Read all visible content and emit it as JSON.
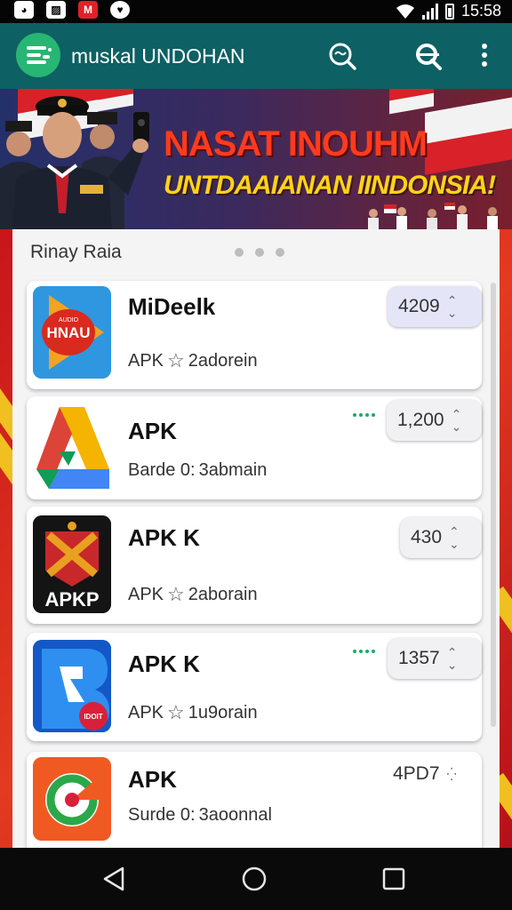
{
  "status_bar": {
    "time": "15:58",
    "icons": [
      "cat-icon",
      "image-icon",
      "gmail-icon",
      "heart-icon"
    ],
    "wifi_icon": "wifi-icon",
    "signal_icon": "signal-icon",
    "battery_icon": "battery-icon"
  },
  "app_bar": {
    "title": "muskal UNDOHAN",
    "logo_icon": "menu-logo-icon",
    "action_icons": [
      "search-icon",
      "search-alt-icon",
      "more-vert-icon"
    ],
    "color": "#0d6063",
    "logo_color": "#27b673"
  },
  "banner": {
    "title_line1": "NASAT INOUHM",
    "title_line2": "UNTDAAIANAN IINDONSIA!",
    "title1_color": "#ff3b1d",
    "title2_color": "#ffd21a"
  },
  "list": {
    "header": "Rinay Raia",
    "items": [
      {
        "name": "MiDeelk",
        "sub_prefix": "APK",
        "sub_icon": "star-icon",
        "sub_text": "2adorein",
        "count": "4209",
        "icon_label": "HNAU",
        "icon_brand": "AUDIO"
      },
      {
        "name": "APK",
        "sub_prefix": "Barde 0:",
        "sub_icon": "",
        "sub_text": "3abmain",
        "count": "1,200"
      },
      {
        "name": "APK K",
        "sub_prefix": "APK",
        "sub_icon": "star-icon",
        "sub_text": "2aborain",
        "count": "430",
        "icon_label": "APKP"
      },
      {
        "name": "APK K",
        "sub_prefix": "APK",
        "sub_icon": "star-icon",
        "sub_text": "1u9orain",
        "count": "1357",
        "icon_badge": "IDOIT"
      },
      {
        "name": "APK",
        "sub_prefix": "Surde 0:",
        "sub_icon": "",
        "sub_text": "3aoonnal",
        "count": "4PD7"
      }
    ]
  },
  "nav_bar": {
    "icons": [
      "back-icon",
      "home-icon",
      "recents-icon"
    ]
  }
}
